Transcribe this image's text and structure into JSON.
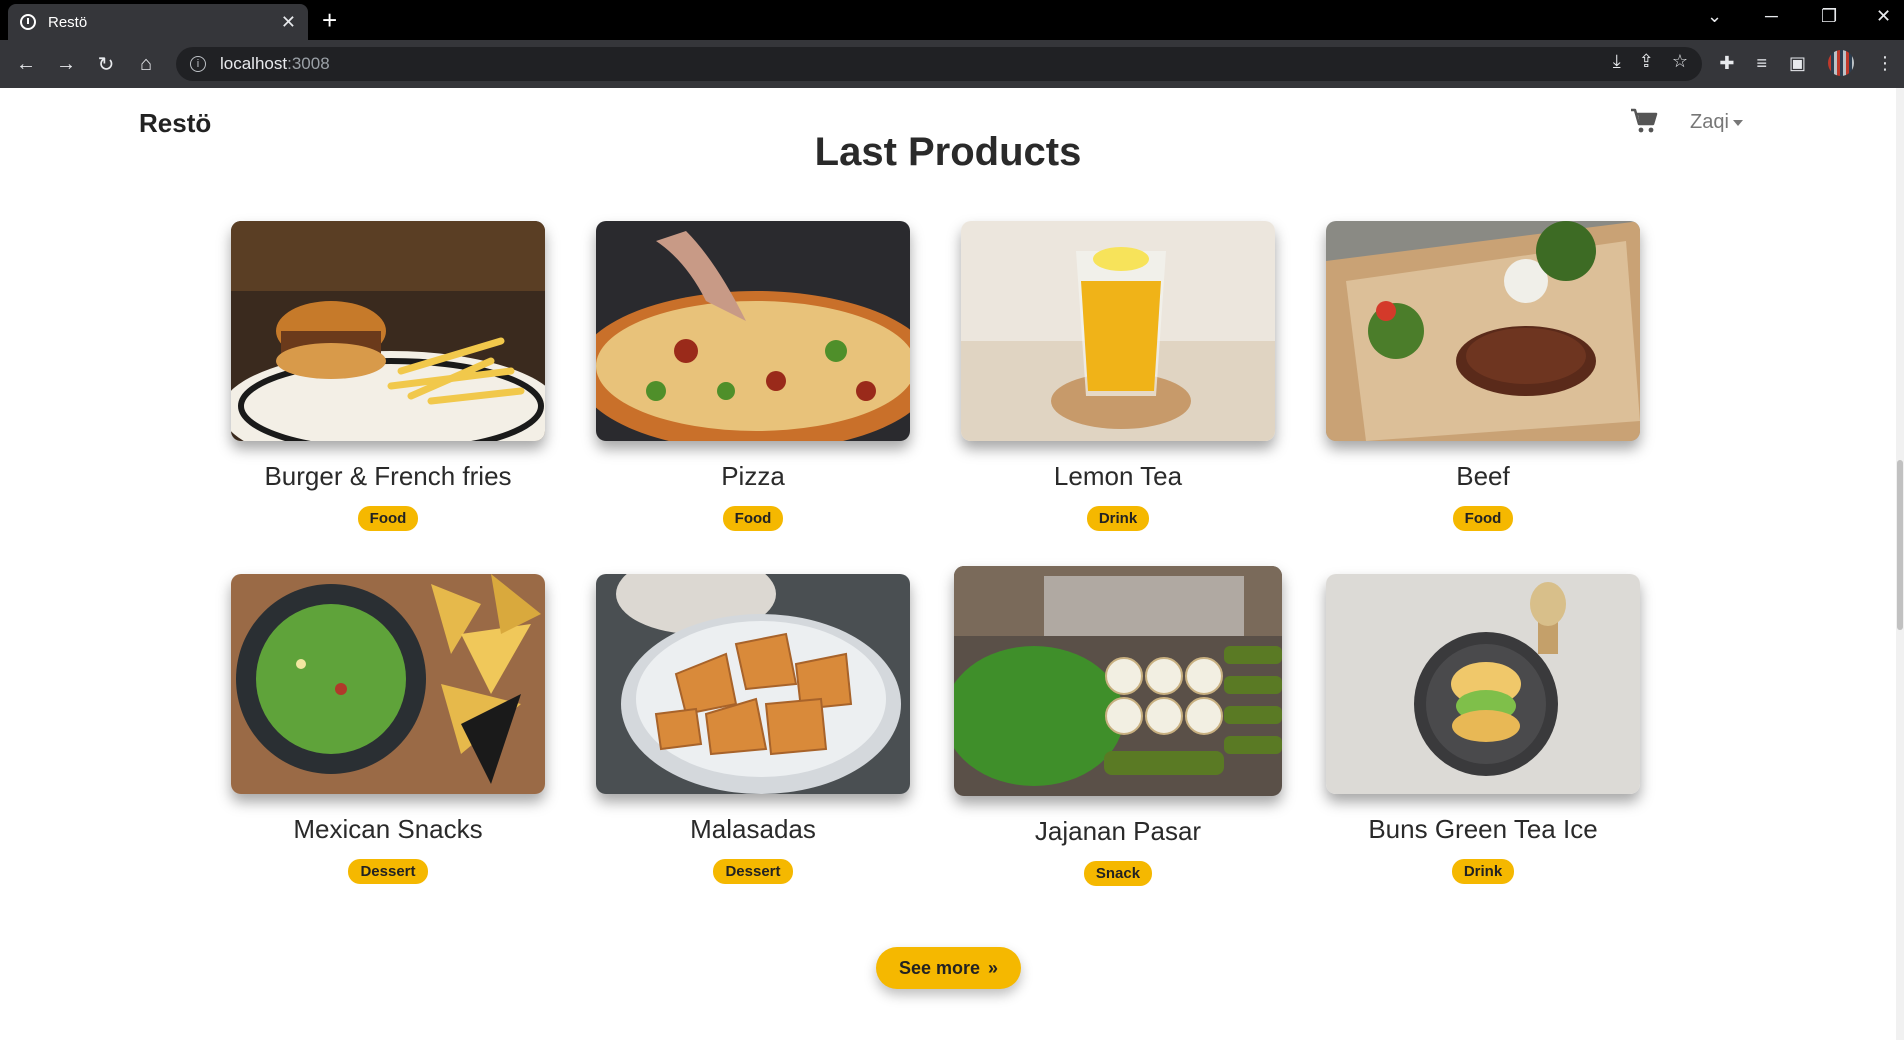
{
  "browser": {
    "tab_title": "Restö",
    "url_host": "localhost",
    "url_port": ":3008"
  },
  "navbar": {
    "brand": "Restö",
    "user": "Zaqi"
  },
  "section": {
    "heading": "Last Products",
    "see_more": "See more"
  },
  "products": [
    {
      "name": "Burger & French fries",
      "category": "Food"
    },
    {
      "name": "Pizza",
      "category": "Food"
    },
    {
      "name": "Lemon Tea",
      "category": "Drink"
    },
    {
      "name": "Beef",
      "category": "Food"
    },
    {
      "name": "Mexican Snacks",
      "category": "Dessert"
    },
    {
      "name": "Malasadas",
      "category": "Dessert"
    },
    {
      "name": "Jajanan Pasar",
      "category": "Snack"
    },
    {
      "name": "Buns Green Tea Ice",
      "category": "Drink"
    }
  ],
  "colors": {
    "accent": "#f5b800",
    "text": "#2a2a2a"
  }
}
